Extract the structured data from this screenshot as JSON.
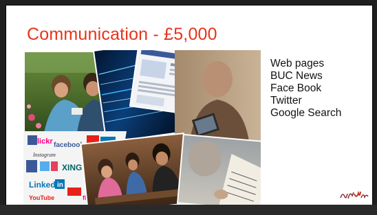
{
  "slide": {
    "title": "Communication - £5,000",
    "bullets": [
      "Web pages",
      "BUC News",
      "Face Book",
      "Twitter",
      "Google Search"
    ]
  },
  "collage": {
    "images": [
      "photo-friends-with-phone",
      "photo-blue-light-streaks",
      "photo-website-screenshot",
      "photo-man-with-tablet",
      "photo-social-media-logos",
      "photo-family-at-table",
      "photo-reading-newspaper"
    ],
    "social_logo_text": [
      "lickr",
      "facebook",
      "Instagram",
      "XING",
      "Linked",
      "in",
      "YouTube",
      "flickr"
    ]
  },
  "decor": {
    "calligraphy_signature": "calligraphy-signature"
  },
  "colors": {
    "title": "#e8331a",
    "frame": "#1f1f1f",
    "slide_bg": "#ffffff"
  }
}
